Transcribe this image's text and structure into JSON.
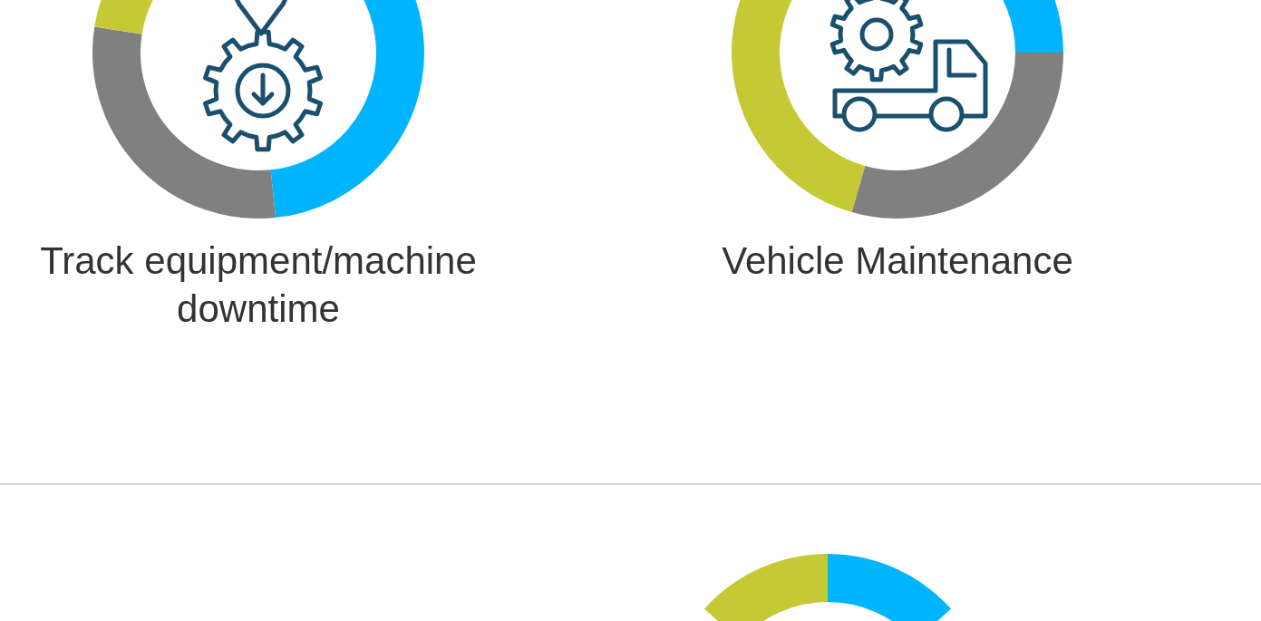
{
  "features": [
    {
      "label": "Track equipment/machine downtime"
    },
    {
      "label": "Vehicle Maintenance"
    }
  ]
}
